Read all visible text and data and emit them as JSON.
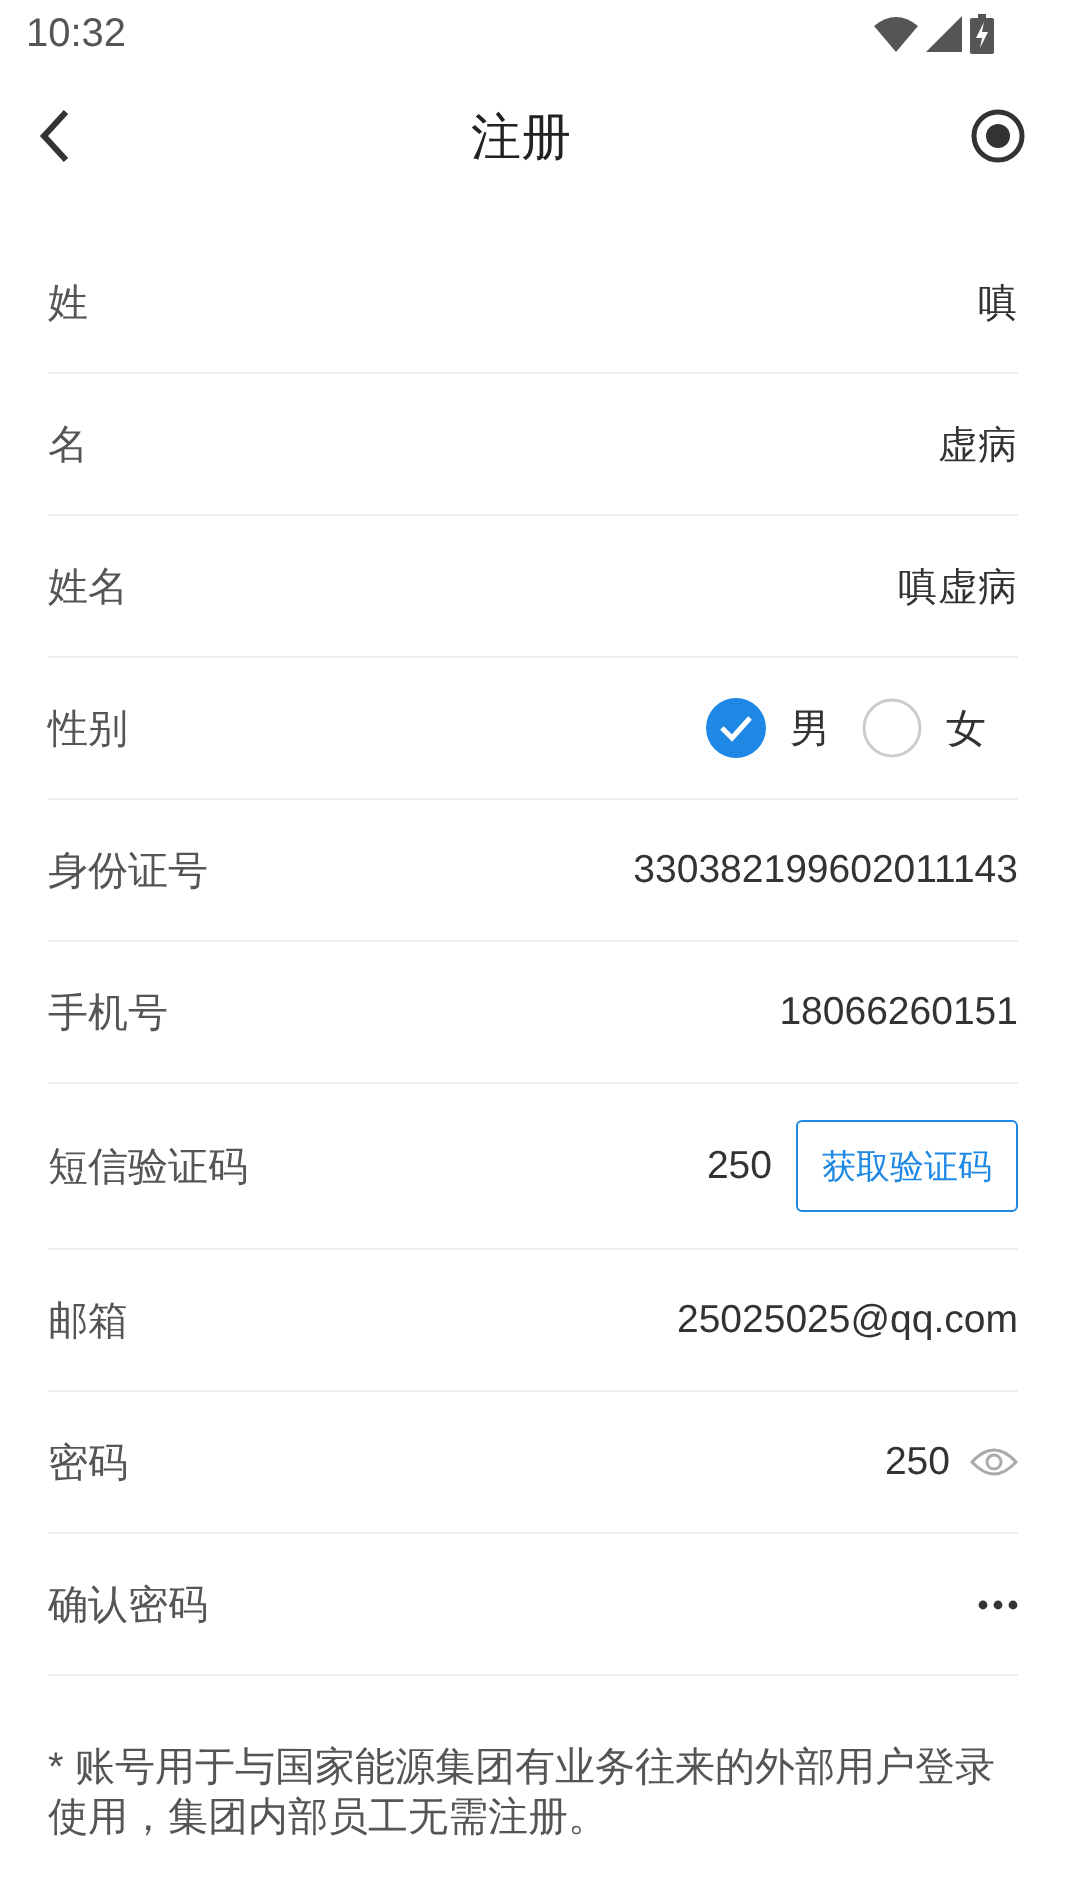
{
  "status_bar": {
    "time": "10:32"
  },
  "header": {
    "title": "注册"
  },
  "rows": [
    {
      "kind": "text",
      "label": "姓",
      "value": "嗔"
    },
    {
      "kind": "text",
      "label": "名",
      "value": "虚病"
    },
    {
      "kind": "text",
      "label": "姓名",
      "value": "嗔虚病"
    },
    {
      "kind": "radio",
      "label": "性别",
      "options": [
        {
          "label": "男",
          "selected": true
        },
        {
          "label": "女",
          "selected": false
        }
      ]
    },
    {
      "kind": "text",
      "label": "身份证号",
      "value": "330382199602011143"
    },
    {
      "kind": "text",
      "label": "手机号",
      "value": "18066260151"
    },
    {
      "kind": "code",
      "label": "短信验证码",
      "value": "250",
      "button": "获取验证码"
    },
    {
      "kind": "text",
      "label": "邮箱",
      "value": "25025025@qq.com"
    },
    {
      "kind": "password",
      "label": "密码",
      "value": "250"
    },
    {
      "kind": "masked",
      "label": "确认密码"
    }
  ],
  "notice": "* 账号用于与国家能源集团有业务往来的外部用户登录使用，集团内部员工无需注册。"
}
